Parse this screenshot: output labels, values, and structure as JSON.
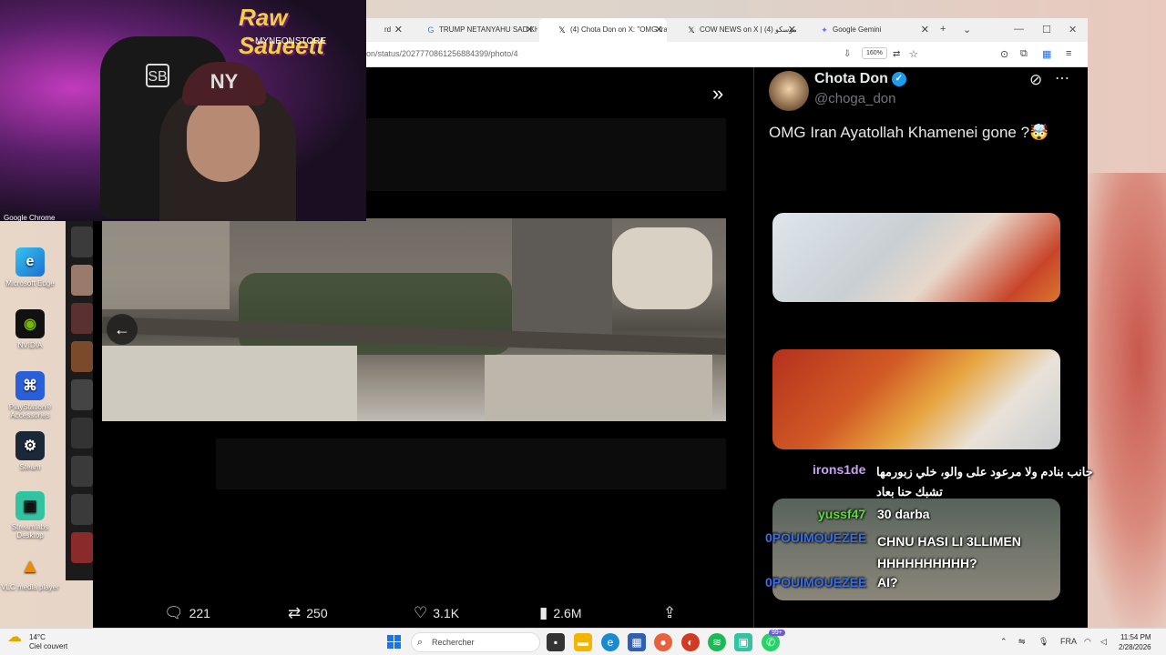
{
  "webcam": {
    "overlay_title": "Raw Saueett",
    "overlay_sub": "MYNEONSTORE",
    "cap_logo": "NY",
    "chair_logo": "SB",
    "below_label": "Google Chrome"
  },
  "desktop_icons": [
    {
      "label": "Microsoft Edge",
      "icon": "edge-icon"
    },
    {
      "label": "NVIDIA",
      "icon": "nvidia-icon"
    },
    {
      "label": "PlayStation® Accessories",
      "icon": "playstation-icon"
    },
    {
      "label": "Steam",
      "icon": "steam-icon"
    },
    {
      "label": "Streamlabs Desktop",
      "icon": "streamlabs-icon"
    },
    {
      "label": "VLC media player",
      "icon": "vlc-icon"
    }
  ],
  "browser": {
    "tabs": [
      {
        "label": "rd"
      },
      {
        "label": "TRUMP NETANYAHU SAD KHAME"
      },
      {
        "label": "(4) Chota Don on X: \"OMG Ira"
      },
      {
        "label": "COW NEWS on X | موسكو (4)"
      },
      {
        "label": "Google Gemini"
      }
    ],
    "url": "on/status/2027770861256884399/photo/4",
    "zoom": "160%"
  },
  "tweet": {
    "name": "Chota Don",
    "handle": "@choga_don",
    "text": "OMG Iran Ayatollah Khamenei gone ?🤯",
    "stats": {
      "replies": "221",
      "retweets": "250",
      "likes": "3.1K",
      "views": "2.6M"
    }
  },
  "chat": [
    {
      "user": "irons1de",
      "message": "جانب بنادم ولا مرعود على والو، خلي زبورمها تشبك حنا بعاد",
      "color": "#c9a2f2"
    },
    {
      "user": "yussf47",
      "message": "30 darba",
      "color": "#5fdc3a"
    },
    {
      "user": "0POUIMOUEZEE",
      "message": "CHNU HASI LI 3LLIMEN HHHHHHHHHH?",
      "color": "#3a6ee8"
    },
    {
      "user": "0POUIMOUEZEE",
      "message": "AI?",
      "color": "#3a6ee8"
    }
  ],
  "taskbar": {
    "weather_temp": "14°C",
    "weather_desc": "Ciel couvert",
    "search_placeholder": "Rechercher",
    "badge": "99+",
    "lang": "FRA",
    "time": "11:54 PM",
    "date": "2/28/2026"
  }
}
